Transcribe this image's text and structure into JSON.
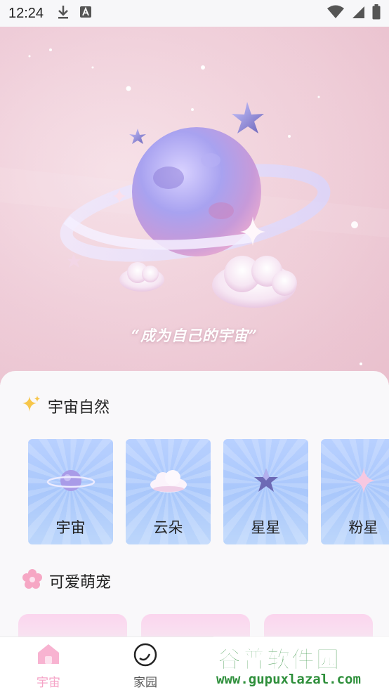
{
  "status_bar": {
    "time": "12:24",
    "icons": [
      "download-icon",
      "a-badge-icon",
      "wifi-icon",
      "signal-icon",
      "battery-icon"
    ]
  },
  "hero": {
    "slogan": "“成为自己的宇宙”",
    "colors": {
      "bg": "#f0cfd9",
      "planet": "#b4a7ee",
      "ring": "#e9e4ff"
    }
  },
  "sections": [
    {
      "title": "宇宙自然",
      "icon": "sparkles-icon",
      "items": [
        {
          "label": "宇宙",
          "icon": "planet-icon"
        },
        {
          "label": "云朵",
          "icon": "cloud-icon"
        },
        {
          "label": "星星",
          "icon": "star-icon"
        },
        {
          "label": "粉星",
          "icon": "pink-sparkle-icon"
        }
      ]
    },
    {
      "title": "可爱萌宠",
      "icon": "cherry-blossom-icon"
    }
  ],
  "bottom_nav": {
    "items": [
      {
        "label": "宇宙",
        "icon": "home-icon",
        "active": true
      },
      {
        "label": "家园",
        "icon": "circle-icon",
        "active": false
      }
    ],
    "active_color": "#f5a3c7"
  },
  "watermark": {
    "title": "谷普软件园",
    "url": "www.gupuxlazal.com"
  }
}
